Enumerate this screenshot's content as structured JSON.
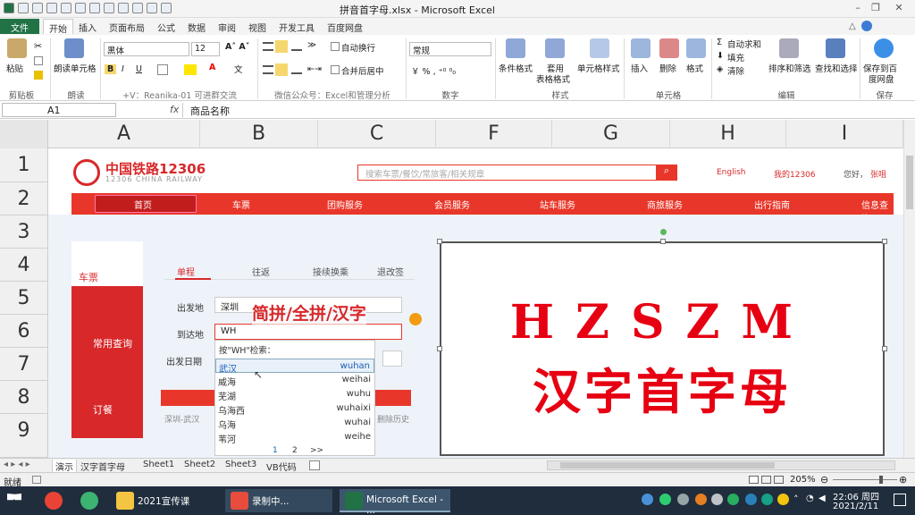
{
  "window": {
    "title": "拼音首字母.xlsx - Microsoft Excel"
  },
  "tabs": [
    "文件",
    "开始",
    "插入",
    "页面布局",
    "公式",
    "数据",
    "审阅",
    "视图",
    "开发工具",
    "百度网盘"
  ],
  "ribbon": {
    "paste": "粘贴",
    "doc_table": "朗读单元格",
    "font_name": "黑体",
    "font_size": "12",
    "wrap": "自动换行",
    "merge": "合并后居中",
    "number_format": "常规",
    "cond_format": "条件格式",
    "table_format_1": "套用",
    "table_format_2": "表格格式",
    "cell_style": "单元格样式",
    "insert": "插入",
    "delete": "删除",
    "format": "格式",
    "autosum": "自动求和",
    "fill": "填充",
    "clear": "清除",
    "sort": "排序和筛选",
    "find": "查找和选择",
    "save1": "保存到百",
    "save2": "度网盘",
    "groups": {
      "clipboard": "剪贴板",
      "read": "朗读",
      "font": "+V：Reanika-01 可进群交流",
      "align": "微信公众号：Excel和管理分析",
      "number": "数字",
      "style": "样式",
      "cells": "单元格",
      "edit": "编辑",
      "save": "保存"
    }
  },
  "formula_bar": {
    "name_box": "A1",
    "fx": "fx",
    "content": "商品名称"
  },
  "columns": [
    "A",
    "B",
    "C",
    "F",
    "G",
    "H",
    "I"
  ],
  "rows": [
    "1",
    "2",
    "3",
    "4",
    "5",
    "6",
    "7",
    "8",
    "9"
  ],
  "web": {
    "logo": "中国铁路12306",
    "logo_sub": "12306 CHINA RAILWAY",
    "search_placeholder": "搜索车票/餐饮/常旅客/相关规章",
    "lang": "English",
    "my": "我的12306",
    "hello": "您好，",
    "login": "张咀",
    "nav": [
      "首页",
      "车票",
      "团购服务",
      "会员服务",
      "站车服务",
      "商旅服务",
      "出行指南",
      "信息查询"
    ],
    "side": [
      "车票",
      "常用查询",
      "订餐"
    ],
    "trip_tabs": [
      "单程",
      "往返",
      "接续换乘",
      "退改签"
    ],
    "from_label": "出发地",
    "from_value": "深圳",
    "to_label": "到达地",
    "to_value": "WH",
    "date_label": "出发日期",
    "overlay": "简拼/全拼/汉字",
    "history": "深圳-武汉",
    "clear_history": "删除历史",
    "drop_head": "按\"WH\"检索：",
    "drop_items": [
      {
        "name": "武汉",
        "py": "wuhan"
      },
      {
        "name": "威海",
        "py": "weihai"
      },
      {
        "name": "芜湖",
        "py": "wuhu"
      },
      {
        "name": "乌海西",
        "py": "wuhaixi"
      },
      {
        "name": "乌海",
        "py": "wuhai"
      },
      {
        "name": "苇河",
        "py": "weihe"
      }
    ],
    "pages": [
      "1",
      "2",
      ">>"
    ]
  },
  "image": {
    "line1": "HZSZM",
    "line2": "汉字首字母"
  },
  "sheet_tabs": [
    "演示",
    "汉字首字母",
    "Sheet1",
    "Sheet2",
    "Sheet3",
    "VB代码"
  ],
  "status": {
    "ready": "就绪",
    "zoom": "205%"
  },
  "taskbar": {
    "apps": [
      "2021宣传课",
      "录制中...",
      "Microsoft Excel - ..."
    ],
    "time": "22:06 周四",
    "date": "2021/2/11"
  },
  "colors": {
    "excel_green": "#217346",
    "rail_red": "#e8372a",
    "title_red": "#e60012"
  }
}
